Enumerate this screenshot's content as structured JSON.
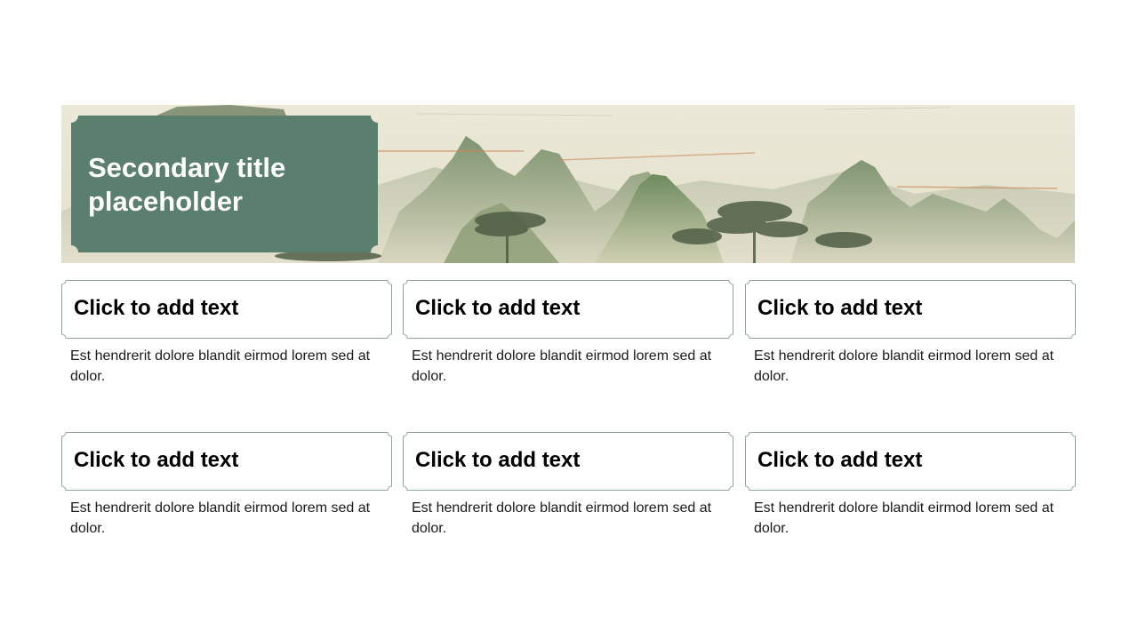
{
  "slide": {
    "title": "Secondary title placeholder",
    "cards": [
      {
        "title": "Click to add text",
        "desc": "Est hendrerit dolore blandit eirmod lorem sed at dolor."
      },
      {
        "title": "Click to add text",
        "desc": "Est hendrerit dolore blandit eirmod lorem sed at dolor."
      },
      {
        "title": "Click to add text",
        "desc": "Est hendrerit dolore blandit eirmod lorem sed at dolor."
      },
      {
        "title": "Click to add text",
        "desc": "Est hendrerit dolore blandit eirmod lorem sed at dolor."
      },
      {
        "title": "Click to add text",
        "desc": "Est hendrerit dolore blandit eirmod lorem sed at dolor."
      },
      {
        "title": "Click to add text",
        "desc": "Est hendrerit dolore blandit eirmod lorem sed at dolor."
      }
    ]
  },
  "colors": {
    "title_box": "#5b7f6e",
    "card_border": "#8fa69c",
    "banner_sky": "#ebe7d6"
  }
}
